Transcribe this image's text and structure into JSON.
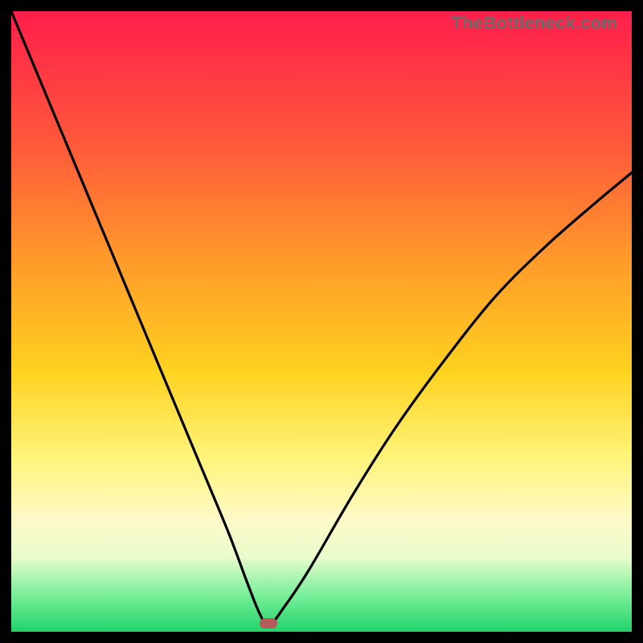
{
  "watermark": "TheBottleneck.com",
  "marker": {
    "cx_frac": 0.415,
    "cy_frac": 0.986
  },
  "chart_data": {
    "type": "line",
    "title": "",
    "xlabel": "",
    "ylabel": "",
    "xlim": [
      0,
      100
    ],
    "ylim": [
      0,
      100
    ],
    "series": [
      {
        "name": "left-branch",
        "x": [
          0,
          5,
          10,
          15,
          20,
          25,
          30,
          35,
          38,
          40,
          41.5
        ],
        "y": [
          100,
          88,
          76,
          64,
          52,
          40,
          28,
          16,
          8,
          3,
          1
        ]
      },
      {
        "name": "right-branch",
        "x": [
          41.5,
          44,
          48,
          55,
          62,
          70,
          78,
          86,
          94,
          100
        ],
        "y": [
          1,
          4,
          10,
          22,
          33,
          44,
          54,
          62,
          69,
          74
        ]
      }
    ],
    "marker": {
      "x": 41.5,
      "y": 1.4
    },
    "gradient_stops": [
      {
        "pos": 0,
        "color": "#ff1e4b"
      },
      {
        "pos": 22,
        "color": "#ff5a3a"
      },
      {
        "pos": 40,
        "color": "#ff9a2a"
      },
      {
        "pos": 58,
        "color": "#ffd21f"
      },
      {
        "pos": 72,
        "color": "#fff47a"
      },
      {
        "pos": 82,
        "color": "#fdf9c8"
      },
      {
        "pos": 88,
        "color": "#e8fccb"
      },
      {
        "pos": 94,
        "color": "#7aef9a"
      },
      {
        "pos": 100,
        "color": "#22d36a"
      }
    ]
  }
}
